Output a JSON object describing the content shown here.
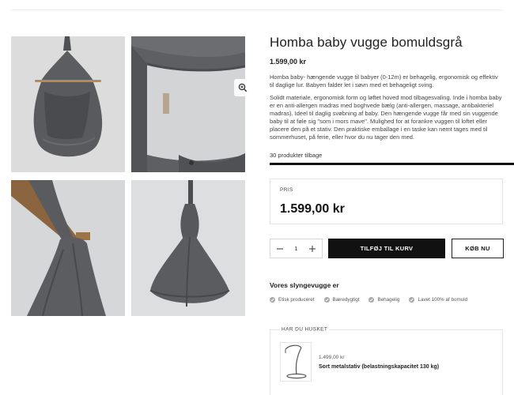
{
  "product": {
    "title": "Homba baby vugge bomuldsgrå",
    "price": "1.599,00 kr",
    "description": [
      "Homba baby- hængende vugge  til babyer (0-12m) er behagelig, ergonomisk og effektiv til daglige lur. Babyen falder let i søvn med et behageligt sving.",
      "Solidt materiale, ergonomisk form og løftet hoved mod tilbagesvaling. Inde i homba baby  er en anti-allergen madras med boghvede bælg (anti-allergen, massage, antibakteriel madras). Ideel til daglig svøbning af baby. Den hængende vugge får med sin vuggende baby til at føle sig \"som i mors mave\". Mulighed for at forankre vuggen til loftet eller placere den på et stativ. Den praktiske emballage i en taske kan nemt tages med til sommerhuset, på ferie, eller hvor du nu tager den med."
    ],
    "stock": "30 produkter tilbage"
  },
  "price_box": {
    "label": "PRIS",
    "value": "1.599,00 kr"
  },
  "cart": {
    "quantity": "1",
    "minus_icon": "minus-icon",
    "plus_icon": "plus-icon",
    "add_label": "TILFØJ TIL KURV",
    "buy_label": "KØB NU"
  },
  "features": {
    "title": "Vores slyngevugge er",
    "items": [
      "Etisk produceret",
      "Bæredygtigt",
      "Behagelig",
      "Lavet 100% af bomuld"
    ],
    "icon": "check-icon"
  },
  "reminder": {
    "label": "HAR DU HUSKET",
    "price": "1.499,00 kr",
    "name": "Sort metalstativ (belastningskapacitet 130 kg)"
  },
  "gallery": {
    "zoom_icon": "zoom-in-icon"
  },
  "colors": {
    "primary": "#111111",
    "fabric": "#58595d",
    "background": "#d8d9da",
    "wood": "#b68a55",
    "check": "#a9a9a9"
  }
}
